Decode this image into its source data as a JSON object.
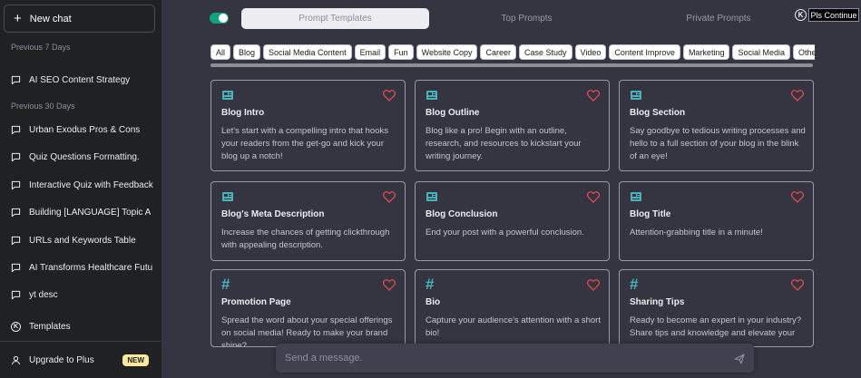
{
  "sidebar": {
    "new_chat_label": "New chat",
    "section_7_days": "Previous 7 Days",
    "section_30_days": "Previous 30 Days",
    "recent_7": [
      {
        "label": "AI SEO Content Strategy"
      }
    ],
    "recent_30": [
      {
        "label": "Urban Exodus Pros & Cons"
      },
      {
        "label": "Quiz Questions Formatting."
      },
      {
        "label": "Interactive Quiz with Feedback"
      },
      {
        "label": "Building [LANGUAGE] Topic A"
      },
      {
        "label": "URLs and Keywords Table"
      },
      {
        "label": "AI Transforms Healthcare Futu"
      },
      {
        "label": "yt desc"
      }
    ],
    "templates_label": "Templates",
    "templates_icon_letter": "K",
    "upgrade_label": "Upgrade to Plus",
    "new_badge": "NEW"
  },
  "topbar": {
    "toggle_on": true,
    "tabs": [
      {
        "label": "Prompt Templates",
        "active": true
      },
      {
        "label": "Top Prompts",
        "active": false
      },
      {
        "label": "Private Prompts",
        "active": false
      }
    ],
    "k_icon_letter": "K",
    "continue_label": "Pls Continue"
  },
  "categories": [
    "All",
    "Blog",
    "Social Media Content",
    "Email",
    "Fun",
    "Website Copy",
    "Career",
    "Case Study",
    "Video",
    "Content Improve",
    "Marketing",
    "Social Media",
    "Other"
  ],
  "cards": [
    {
      "icon": "newspaper-icon",
      "title": "Blog Intro",
      "desc": "Let's start with a compelling intro that hooks your readers from the get-go and kick your blog up a notch!"
    },
    {
      "icon": "newspaper-icon",
      "title": "Blog Outline",
      "desc": "Blog like a pro! Begin with an outline, research, and resources to kickstart your writing journey."
    },
    {
      "icon": "newspaper-icon",
      "title": "Blog Section",
      "desc": "Say goodbye to tedious writing processes and hello to a full section of your blog in the blink of an eye!"
    },
    {
      "icon": "newspaper-icon",
      "title": "Blog's Meta Description",
      "desc": "Increase the chances of getting clickthrough with appealing description."
    },
    {
      "icon": "newspaper-icon",
      "title": "Blog Conclusion",
      "desc": "End your post with a powerful conclusion."
    },
    {
      "icon": "newspaper-icon",
      "title": "Blog Title",
      "desc": "Attention-grabbing title in a minute!"
    },
    {
      "icon": "hash-icon",
      "icon_text": "#",
      "title": "Promotion Page",
      "desc": "Spread the word about your special offerings on social media! Ready to make your brand shine?"
    },
    {
      "icon": "hash-icon",
      "icon_text": "#",
      "title": "Bio",
      "desc": "Capture your audience's attention with a short bio!"
    },
    {
      "icon": "hash-icon",
      "icon_text": "#",
      "title": "Sharing Tips",
      "desc": "Ready to become an expert in your industry? Share tips and knowledge and elevate your"
    }
  ],
  "composer": {
    "placeholder": "Send a message."
  },
  "colors": {
    "sidebar_bg": "#202123",
    "main_bg": "#343541",
    "accent_green": "#10a37f",
    "icon_teal": "#4ab3b8",
    "heart_red": "#e5484d",
    "badge_yellow": "#fae69e"
  }
}
